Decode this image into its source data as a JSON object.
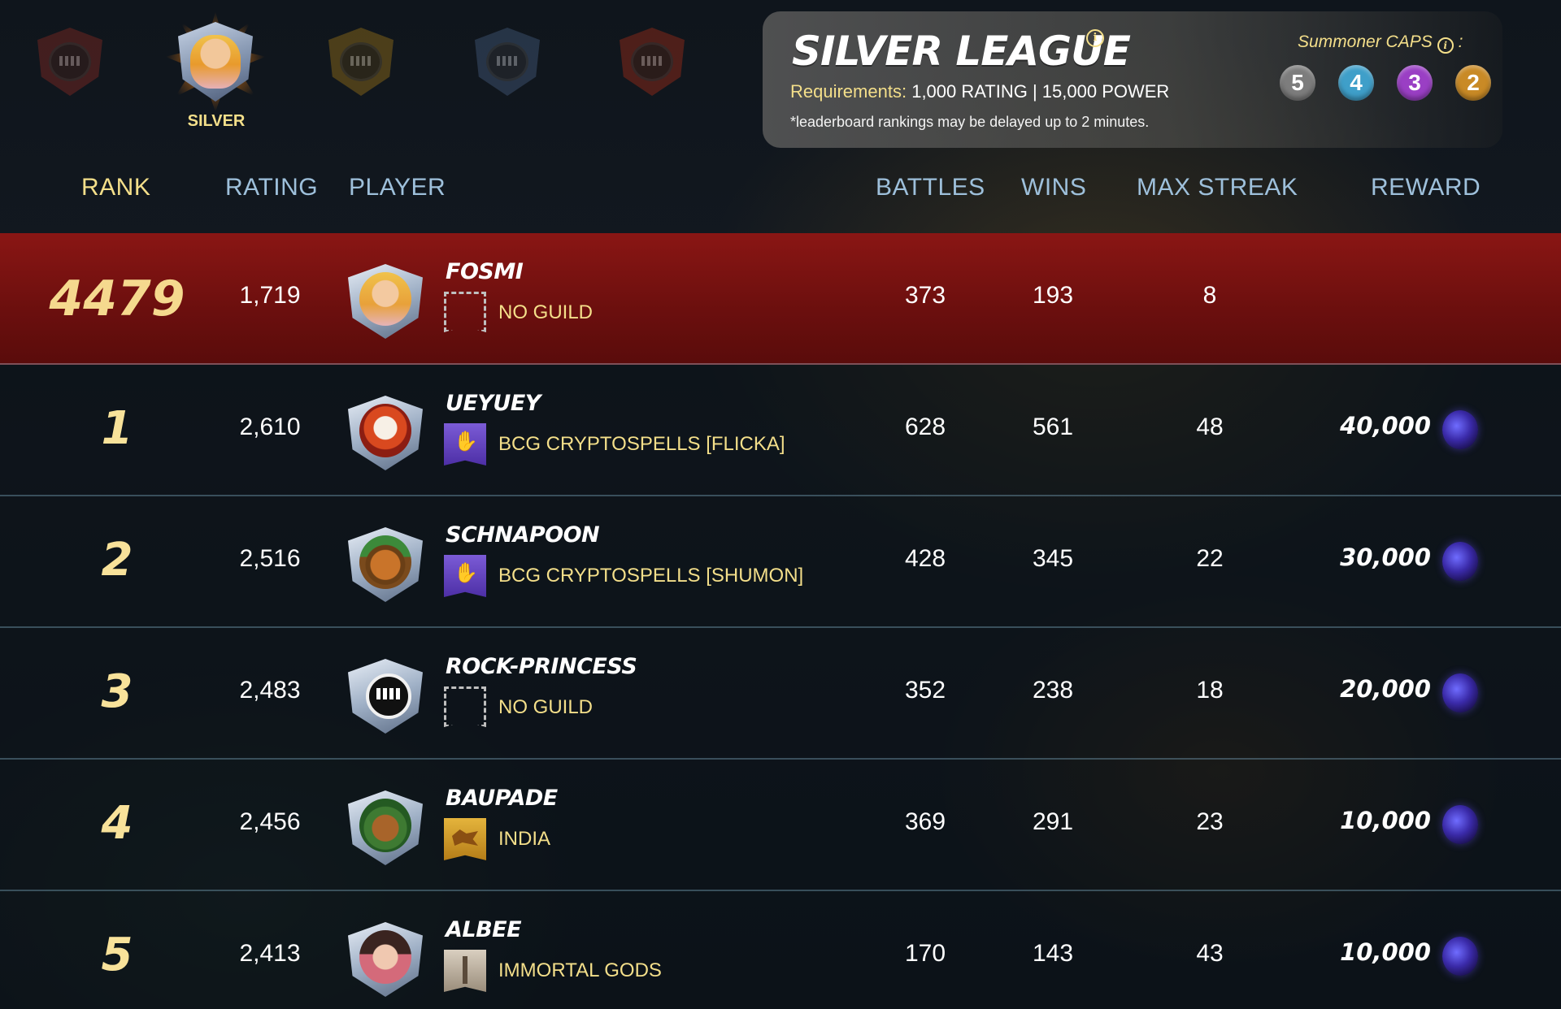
{
  "league_nav": {
    "active_label": "SILVER",
    "leagues": [
      {
        "name": "bronze-league-icon",
        "color": "#7a2a22"
      },
      {
        "name": "silver-league-icon",
        "color": "#9fb0c6"
      },
      {
        "name": "gold-league-icon",
        "color": "#8a6a1c"
      },
      {
        "name": "diamond-league-icon",
        "color": "#3b4f6a"
      },
      {
        "name": "champion-league-icon",
        "color": "#8a2a1a"
      }
    ]
  },
  "panel": {
    "title": "SILVER LEAGUE",
    "requirements_label": "Requirements:",
    "requirements_value": "1,000 RATING | 15,000 POWER",
    "note": "*leaderboard rankings may be delayed up to 2 minutes.",
    "caps_label": "Summoner CAPS",
    "caps_suffix": ":",
    "caps": [
      {
        "value": "5",
        "color": "#7d7d7d"
      },
      {
        "value": "4",
        "color": "#3f9fc9"
      },
      {
        "value": "3",
        "color": "#9a3fc4"
      },
      {
        "value": "2",
        "color": "#c98a26"
      }
    ]
  },
  "columns": {
    "rank": "RANK",
    "rating": "RATING",
    "player": "PLAYER",
    "battles": "BATTLES",
    "wins": "WINS",
    "max_streak": "MAX STREAK",
    "reward": "REWARD"
  },
  "rows": [
    {
      "rank": "4479",
      "rating": "1,719",
      "player": "FOSMI",
      "guild": "NO GUILD",
      "battles": "373",
      "wins": "193",
      "max_streak": "8",
      "reward": ""
    },
    {
      "rank": "1",
      "rating": "2,610",
      "player": "UEYUEY",
      "guild": "BCG CRYPTOSPELLS [FLICKA]",
      "battles": "628",
      "wins": "561",
      "max_streak": "48",
      "reward": "40,000"
    },
    {
      "rank": "2",
      "rating": "2,516",
      "player": "SCHNAPOON",
      "guild": "BCG CRYPTOSPELLS [SHUMON]",
      "battles": "428",
      "wins": "345",
      "max_streak": "22",
      "reward": "30,000"
    },
    {
      "rank": "3",
      "rating": "2,483",
      "player": "ROCK-PRINCESS",
      "guild": "NO GUILD",
      "battles": "352",
      "wins": "238",
      "max_streak": "18",
      "reward": "20,000"
    },
    {
      "rank": "4",
      "rating": "2,456",
      "player": "BAUPADE",
      "guild": "INDIA",
      "battles": "369",
      "wins": "291",
      "max_streak": "23",
      "reward": "10,000"
    },
    {
      "rank": "5",
      "rating": "2,413",
      "player": "ALBEE",
      "guild": "IMMORTAL GODS",
      "battles": "170",
      "wins": "143",
      "max_streak": "43",
      "reward": "10,000"
    }
  ],
  "colors": {
    "accent_gold": "#f4df8a",
    "header_blue": "#9ec0db",
    "highlight_row": "#7a1412"
  }
}
